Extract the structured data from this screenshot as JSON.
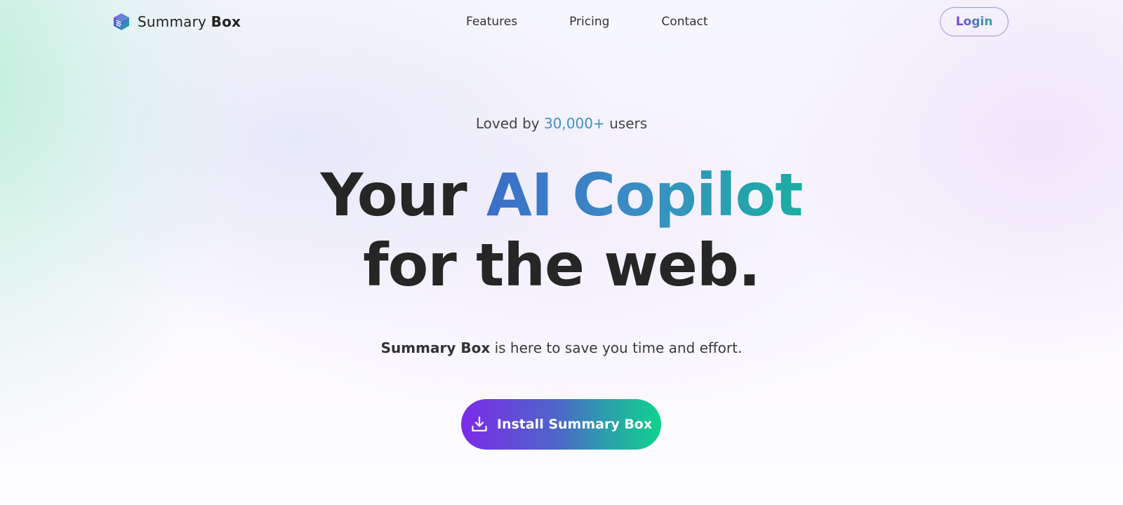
{
  "brand": {
    "name_regular": "Summary",
    "name_bold": "Box",
    "logo_icon": "hexagon-logo-icon"
  },
  "nav": {
    "items": [
      "Features",
      "Pricing",
      "Contact"
    ],
    "login_label": "Login"
  },
  "hero": {
    "loved_prefix": "Loved by",
    "loved_count": "30,000+",
    "loved_suffix": "users",
    "headline_part1": "Your",
    "headline_accent": "AI Copilot",
    "headline_line2": "for the web.",
    "sub_bold": "Summary Box",
    "sub_rest": "is here to save you time and effort.",
    "cta_label": "Install Summary Box",
    "cta_icon": "download-icon"
  },
  "colors": {
    "accent_purple": "#7b2be8",
    "accent_green": "#0fd28d",
    "accent_blue": "#3b6ec9",
    "accent_teal": "#1aaea2"
  }
}
